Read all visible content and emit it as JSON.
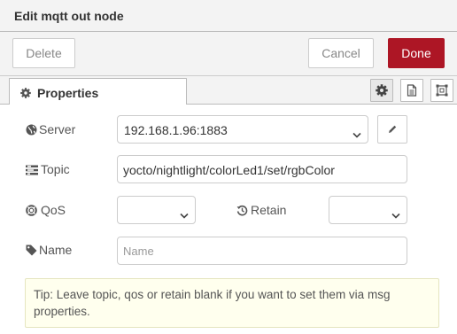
{
  "dialog": {
    "title": "Edit mqtt out node"
  },
  "toolbar": {
    "delete_label": "Delete",
    "cancel_label": "Cancel",
    "done_label": "Done"
  },
  "tabs": {
    "properties_label": "Properties"
  },
  "form": {
    "server": {
      "label": "Server",
      "value": "192.168.1.96:1883"
    },
    "topic": {
      "label": "Topic",
      "value": "yocto/nightlight/colorLed1/set/rgbColor"
    },
    "qos": {
      "label": "QoS",
      "value": ""
    },
    "retain": {
      "label": "Retain",
      "value": ""
    },
    "name": {
      "label": "Name",
      "value": "",
      "placeholder": "Name"
    }
  },
  "tip": {
    "text": "Tip: Leave topic, qos or retain blank if you want to set them via msg properties."
  },
  "colors": {
    "done_bg": "#ad1625",
    "tip_bg": "#ffffee",
    "border": "#cccccc"
  }
}
